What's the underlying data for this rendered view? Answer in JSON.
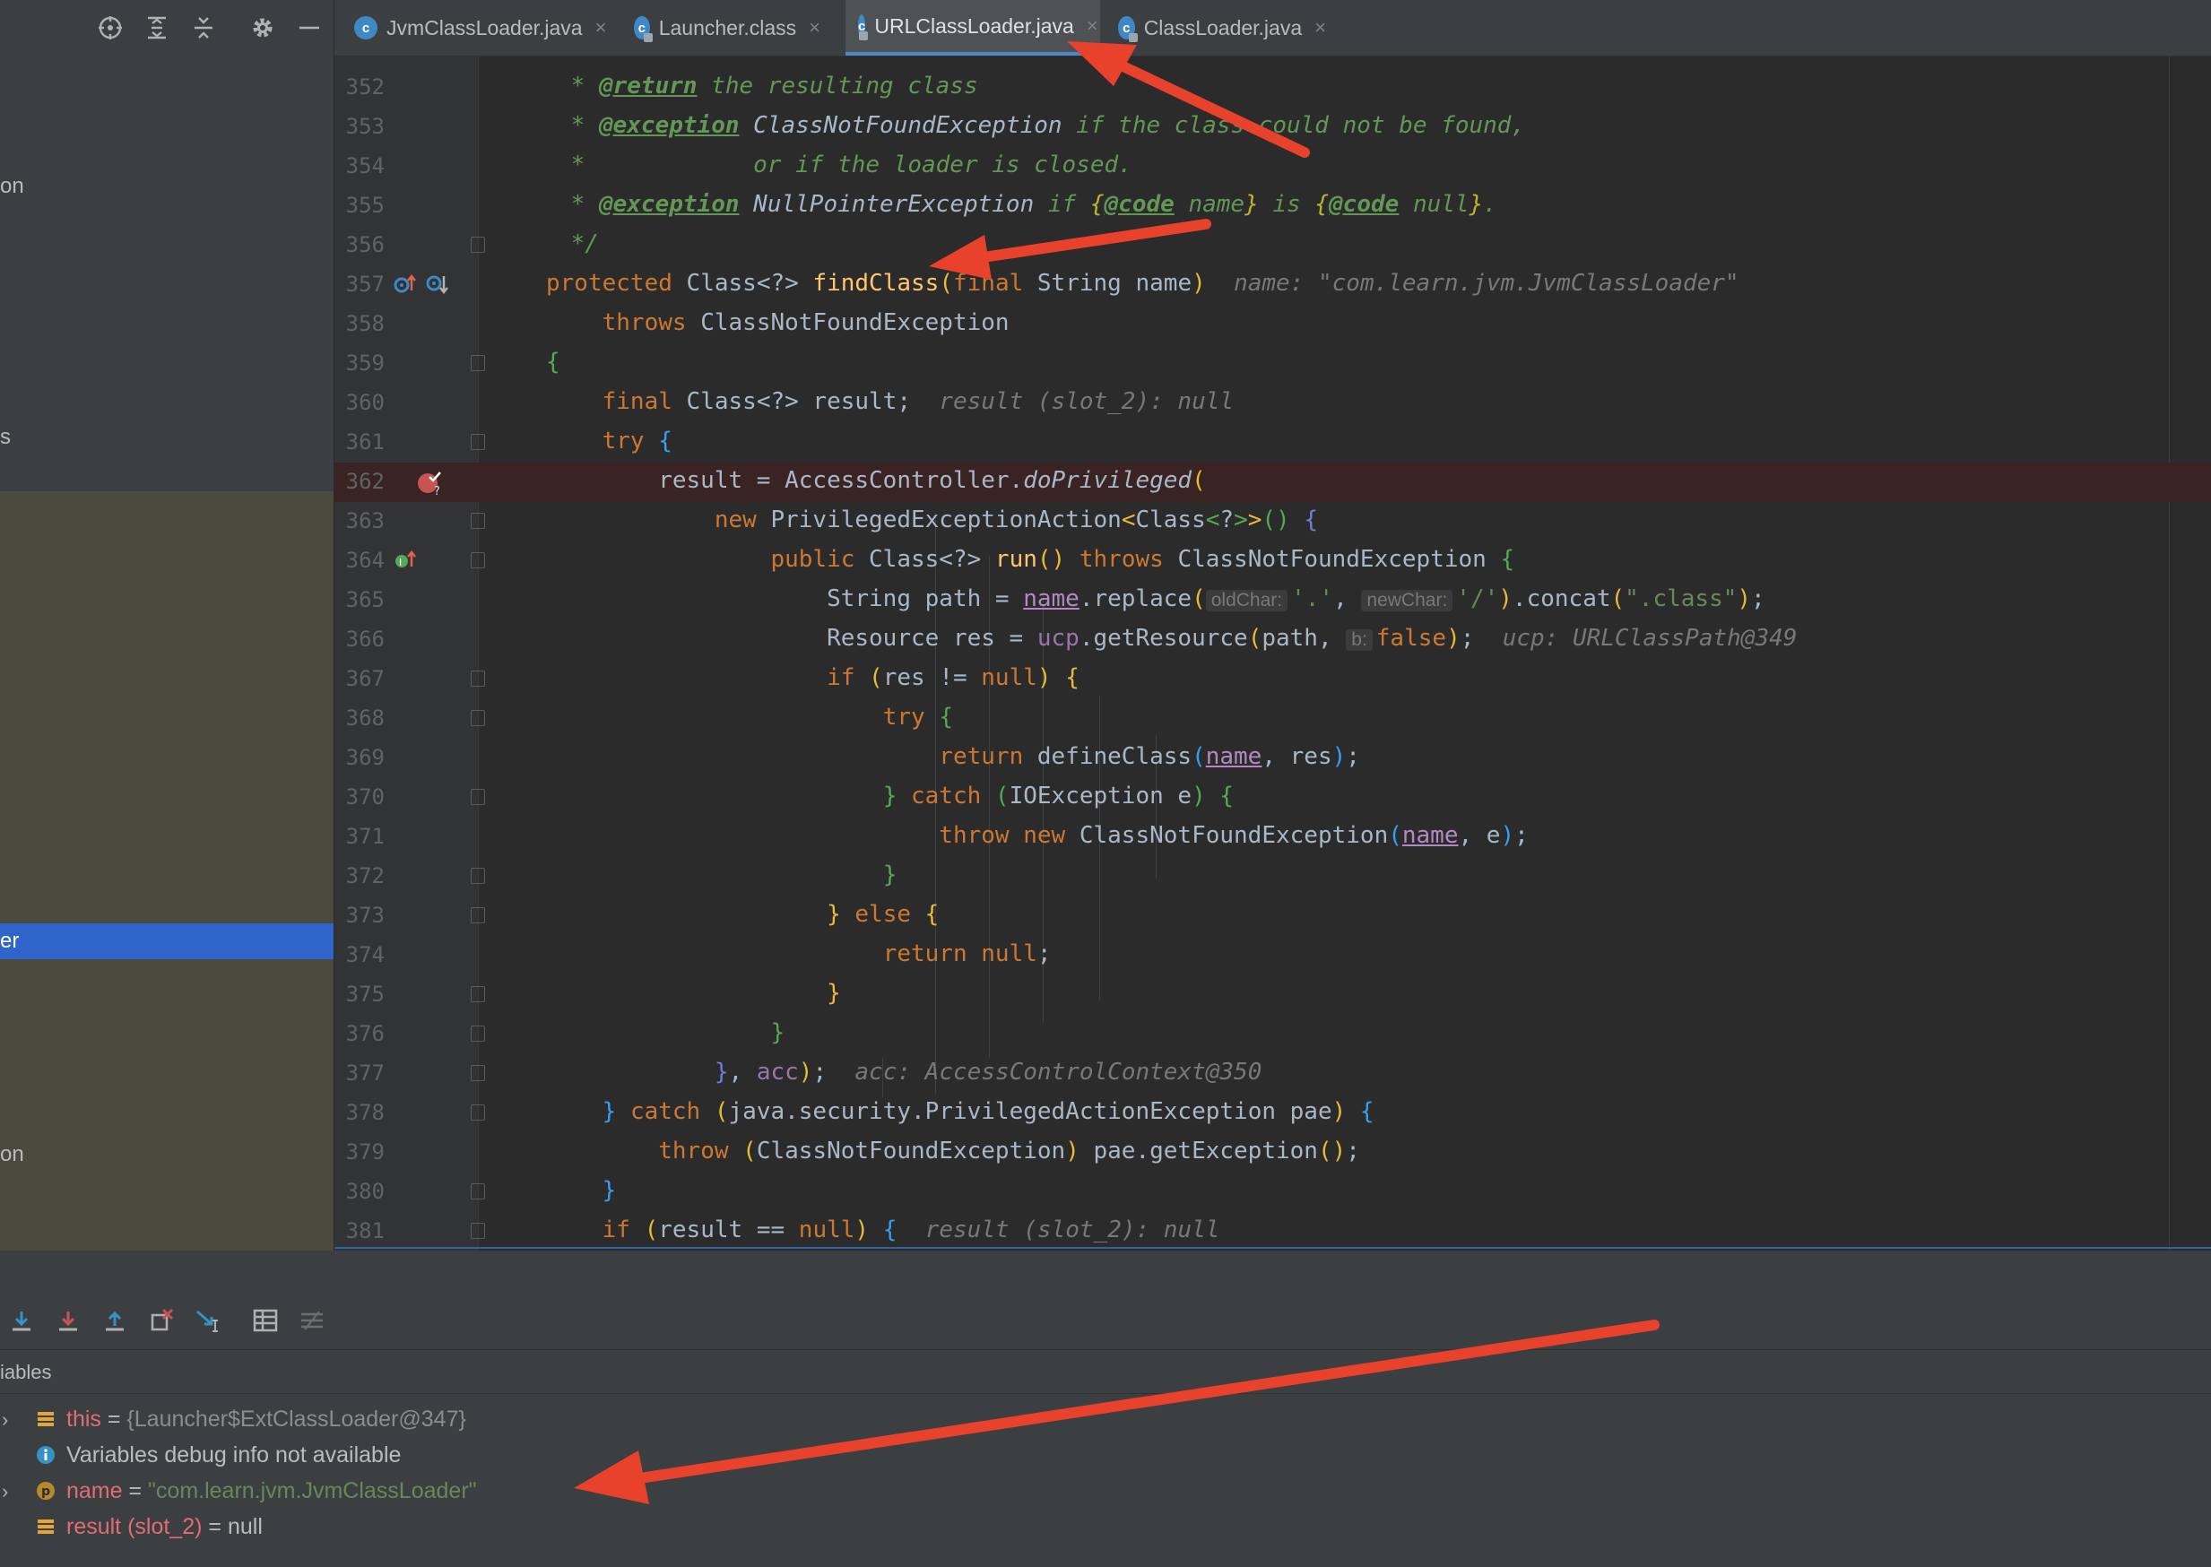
{
  "project_panel": {
    "fragments": [
      "on",
      "s",
      "on"
    ],
    "selected_fragment": "er"
  },
  "tabs": [
    {
      "label": "JvmClassLoader.java",
      "icon": "java-class-icon",
      "locked": false,
      "active": false
    },
    {
      "label": "Launcher.class",
      "icon": "class-file-icon",
      "locked": true,
      "active": false
    },
    {
      "label": "URLClassLoader.java",
      "icon": "java-class-locked-icon",
      "locked": true,
      "active": true
    },
    {
      "label": "ClassLoader.java",
      "icon": "java-class-locked-icon",
      "locked": true,
      "active": false
    }
  ],
  "tab_close_glyph": "×",
  "editor": {
    "line_numbers": [
      "352",
      "353",
      "354",
      "355",
      "356",
      "357",
      "358",
      "359",
      "360",
      "361",
      "362",
      "363",
      "364",
      "365",
      "366",
      "367",
      "368",
      "369",
      "370",
      "371",
      "372",
      "373",
      "374",
      "375",
      "376",
      "377",
      "378",
      "379",
      "380",
      "381"
    ],
    "breakpoint_line": "362",
    "hints": {
      "name_hint": "name: \"com.learn.jvm.JvmClassLoader\"",
      "result_hint": "result (slot_2): null",
      "ucp_hint": "ucp: URLClassPath@349",
      "acc_hint": "acc: AccessControlContext@350",
      "result_hint_2": "result (slot_2): null",
      "old_char": "oldChar:",
      "new_char": "newChar:",
      "b_hint": "b:"
    }
  },
  "debugger": {
    "variables_label": "iables",
    "variables": [
      {
        "name": "this",
        "eq": " = ",
        "value": "{Launcher$ExtClassLoader@347}",
        "kind": "object",
        "expandable": true
      },
      {
        "info": "Variables debug info not available"
      },
      {
        "name": "name",
        "eq": " = ",
        "value": "\"com.learn.jvm.JvmClassLoader\"",
        "kind": "string",
        "expandable": true
      },
      {
        "name": "result (slot_2)",
        "eq": " = ",
        "value": "null",
        "kind": "null",
        "expandable": false
      }
    ]
  },
  "colors": {
    "editor_bg": "#2b2b2b",
    "keyword": "#cc7832",
    "function": "#ffc66d",
    "string": "#6a8759",
    "comment": "#629755",
    "selection": "#2f65ca",
    "annotation_arrow": "#e8412c"
  }
}
